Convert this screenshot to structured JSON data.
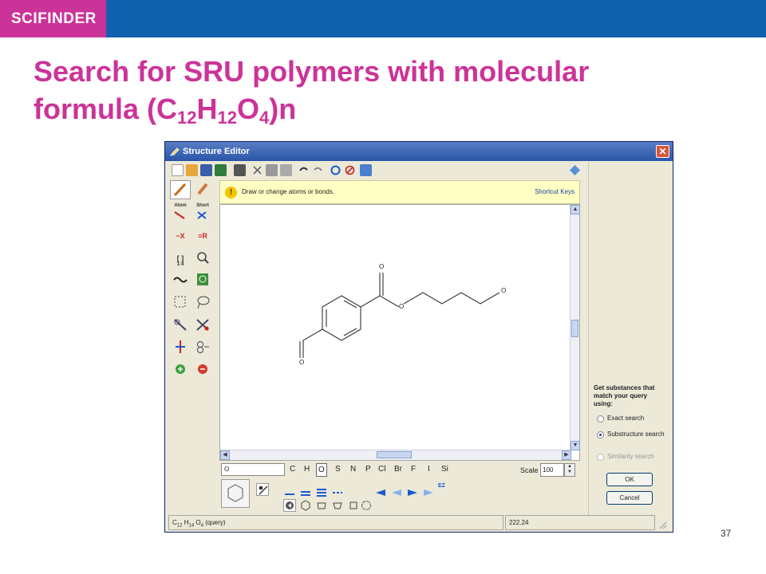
{
  "slide": {
    "brand": "SCIFINDER",
    "title_line1": "Search for SRU polymers with molecular",
    "title_formula_prefix": "formula (C",
    "title_sub1": "12",
    "title_h": "H",
    "title_sub2": "12",
    "title_o": "O",
    "title_sub3": "4",
    "title_suffix": ")n",
    "page_number": "37"
  },
  "window": {
    "title": "Structure Editor",
    "close_glyph": "✕",
    "hint_text": "Draw or change atoms or bonds.",
    "shortcut_keys": "Shortcut Keys",
    "hint_icon": "!"
  },
  "left_tools": {
    "atom_label": "Atom",
    "short_label": "Short",
    "remove_x": "−X",
    "remove_r": "≡R",
    "bracket": "[ ]",
    "bracket_sub": "1-4"
  },
  "molecule_labels": {
    "o_carbonyl": "O",
    "o_ester": "O",
    "o_terminal": "O",
    "o_aldehyde": "O"
  },
  "atom_bar": {
    "input_value": "O",
    "atoms": [
      "C",
      "H",
      "O",
      "S",
      "N",
      "P",
      "Cl",
      "Br",
      "F",
      "I",
      "Si"
    ],
    "selected_atom": "O",
    "scale_label": "Scale",
    "scale_value": "100",
    "ez_label": "EZ"
  },
  "right_panel": {
    "heading": "Get substances that match your query using:",
    "options": [
      {
        "label": "Exact search",
        "selected": false,
        "disabled": false
      },
      {
        "label": "Substructure search",
        "selected": true,
        "disabled": false
      },
      {
        "label": "Similarity search",
        "selected": false,
        "disabled": true
      }
    ],
    "ok_label": "OK",
    "cancel_label": "Cancel"
  },
  "status": {
    "formula_c": "C",
    "formula_c_sub": "12",
    "formula_h": "H",
    "formula_h_sub": "14",
    "formula_o": "O",
    "formula_o_sub": "4",
    "formula_suffix": "(query)",
    "mass": "222.24"
  },
  "colors": {
    "brand_magenta": "#cc3399",
    "header_blue": "#1061ae",
    "hint_yellow": "#ffffc4",
    "window_gray": "#ece9d8"
  }
}
